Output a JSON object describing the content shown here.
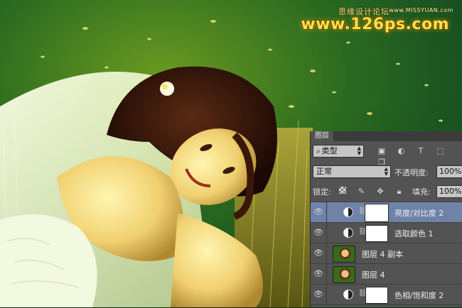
{
  "watermark": {
    "chinese": "思缘设计论坛",
    "small_url": "www.MISSYUAN.com",
    "site": "www.126ps.com"
  },
  "layers_panel": {
    "tab_label": "图层",
    "filter": {
      "kind_label": "类型",
      "icons": [
        "image-filter-icon",
        "adjustment-filter-icon",
        "type-filter-icon",
        "shape-filter-icon",
        "smart-object-filter-icon"
      ]
    },
    "blend_mode": "正常",
    "opacity_label": "不透明度:",
    "opacity_value": "100%",
    "lock_label": "锁定:",
    "fill_label": "填充:",
    "fill_value": "100%",
    "layers": [
      {
        "name": "亮度/对比度 2",
        "type": "adjustment",
        "selected": true
      },
      {
        "name": "选取颜色 1",
        "type": "adjustment",
        "selected": false
      },
      {
        "name": "图层 4 副本",
        "type": "pixel",
        "selected": false
      },
      {
        "name": "图层 4",
        "type": "pixel",
        "selected": false
      },
      {
        "name": "色相/饱和度 2",
        "type": "adjustment",
        "selected": false
      }
    ]
  },
  "colors": {
    "panel_bg": "#535353",
    "selected_row": "#6f82a8",
    "watermark_yellow": "#ffe24a"
  }
}
